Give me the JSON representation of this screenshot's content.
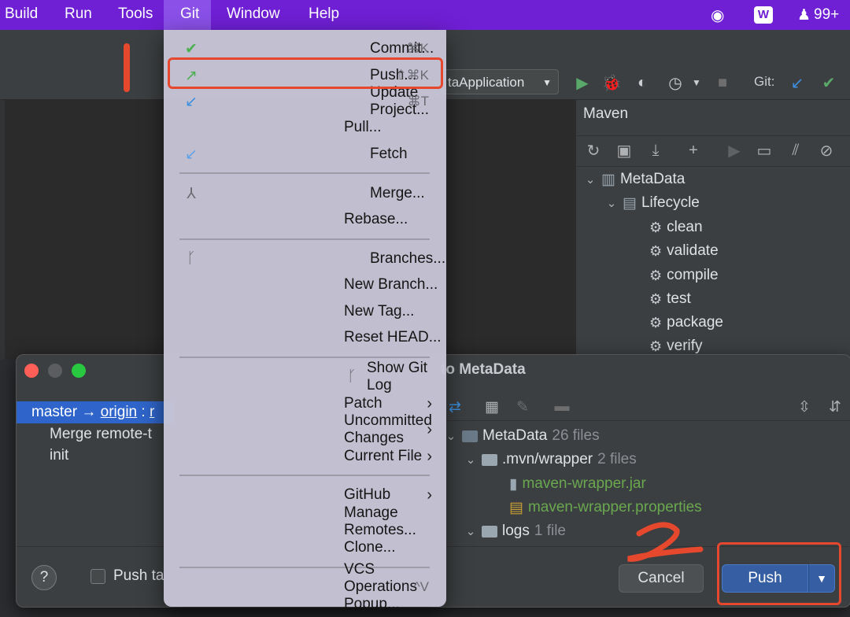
{
  "menubar": {
    "items": [
      "Build",
      "Run",
      "Tools",
      "Git",
      "Window",
      "Help"
    ],
    "notification_count": "99+"
  },
  "toolbar": {
    "run_config": "taApplication",
    "git_label": "Git:"
  },
  "maven": {
    "title": "Maven",
    "project": "MetaData",
    "lifecycle": "Lifecycle",
    "goals": [
      "clean",
      "validate",
      "compile",
      "test",
      "package",
      "verify"
    ]
  },
  "git_menu": {
    "items": [
      {
        "label": "Commit...",
        "shortcut": "⌘K",
        "icon": "check-icon"
      },
      {
        "label": "Push...",
        "shortcut": "⇧⌘K",
        "icon": "push-arrow-icon"
      },
      {
        "label": "Update Project...",
        "shortcut": "⌘T",
        "icon": "update-arrow-icon"
      },
      {
        "label": "Pull...",
        "shortcut": "",
        "icon": ""
      },
      {
        "label": "Fetch",
        "shortcut": "",
        "icon": "fetch-icon"
      },
      {
        "label": "Merge...",
        "shortcut": "",
        "icon": "merge-icon"
      },
      {
        "label": "Rebase...",
        "shortcut": "",
        "icon": ""
      },
      {
        "label": "Branches...",
        "shortcut": "",
        "icon": "branch-icon"
      },
      {
        "label": "New Branch...",
        "shortcut": "",
        "icon": ""
      },
      {
        "label": "New Tag...",
        "shortcut": "",
        "icon": ""
      },
      {
        "label": "Reset HEAD...",
        "shortcut": "",
        "icon": ""
      },
      {
        "label": "Show Git Log",
        "shortcut": "",
        "icon": "git-log-icon"
      },
      {
        "label": "Patch",
        "shortcut": "",
        "icon": ""
      },
      {
        "label": "Uncommitted Changes",
        "shortcut": "",
        "icon": ""
      },
      {
        "label": "Current File",
        "shortcut": "",
        "icon": ""
      },
      {
        "label": "GitHub",
        "shortcut": "",
        "icon": ""
      },
      {
        "label": "Manage Remotes...",
        "shortcut": "",
        "icon": ""
      },
      {
        "label": "Clone...",
        "shortcut": "",
        "icon": ""
      },
      {
        "label": "VCS Operations Popup...",
        "shortcut": "^V",
        "icon": ""
      }
    ]
  },
  "dialog": {
    "title_visible": "to MetaData",
    "branch": {
      "local": "master",
      "arrow": "→",
      "remote": "origin",
      "sep": ":",
      "remote_branch_partial": "r"
    },
    "commits": [
      "Merge remote-t",
      "init"
    ],
    "files": {
      "root": "MetaData",
      "root_count": "26 files",
      "folder1": ".mvn/wrapper",
      "folder1_count": "2 files",
      "file1": "maven-wrapper.jar",
      "file2": "maven-wrapper.properties",
      "folder2": "logs",
      "folder2_count": "1 file"
    },
    "help": "?",
    "push_tags_label": "Push ta",
    "cancel": "Cancel",
    "push": "Push"
  },
  "annotations": {
    "step2": "2"
  },
  "colors": {
    "menubar": "#6f1fd4",
    "annotation": "#e6482e",
    "primary_button": "#365ea3",
    "file_added": "#6aa84f"
  }
}
